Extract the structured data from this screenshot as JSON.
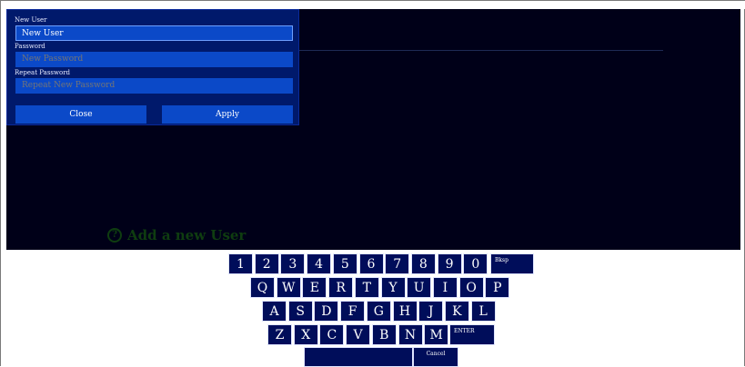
{
  "dialog": {
    "new_user_label": "New User",
    "new_user_value": "New User",
    "password_label": "Password",
    "password_placeholder": "New Password",
    "repeat_label": "Repeat Password",
    "repeat_placeholder": "Repeat New Password",
    "close_label": "Close",
    "apply_label": "Apply"
  },
  "hint": {
    "icon": "question-icon",
    "icon_glyph": "?",
    "text": "Add a new User"
  },
  "keyboard": {
    "row1": [
      "1",
      "2",
      "3",
      "4",
      "5",
      "6",
      "7",
      "8",
      "9",
      "0"
    ],
    "bksp_label": "Bksp",
    "row2": [
      "Q",
      "W",
      "E",
      "R",
      "T",
      "Y",
      "U",
      "I",
      "O",
      "P"
    ],
    "row3": [
      "A",
      "S",
      "D",
      "F",
      "G",
      "H",
      "J",
      "K",
      "L"
    ],
    "row4": [
      "Z",
      "X",
      "C",
      "V",
      "B",
      "N",
      "M"
    ],
    "enter_label": "ENTER",
    "cancel_label": "Cancel"
  },
  "colors": {
    "panel_bg": "#000018",
    "dialog_bg": "#00196b",
    "field_bg": "#0b49c8",
    "key_bg": "#000d5a",
    "hint_text": "#0f3d10"
  }
}
